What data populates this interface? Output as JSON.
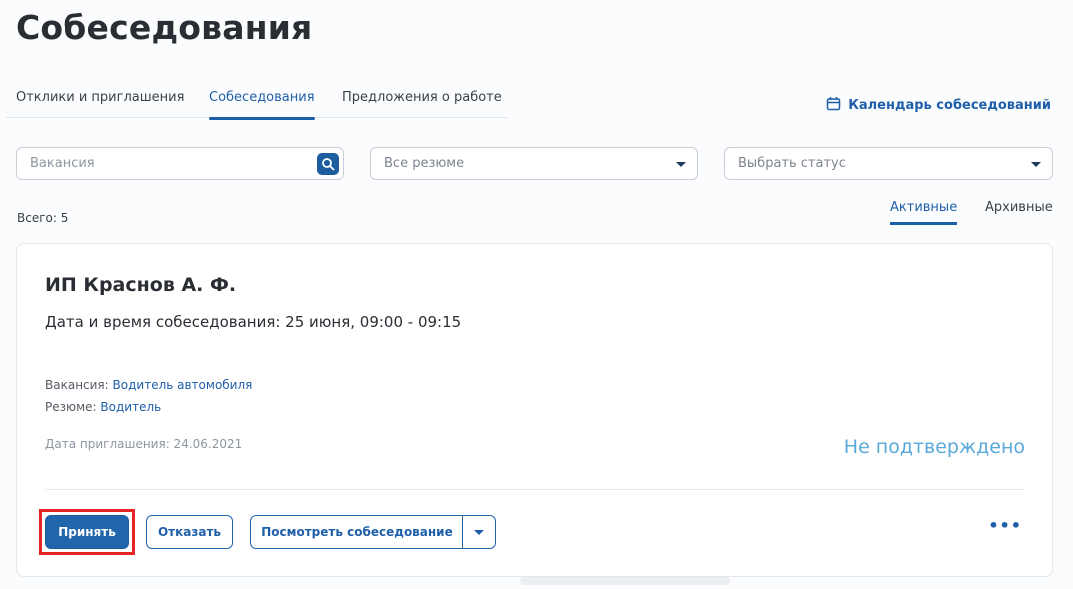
{
  "page": {
    "title": "Собеседования"
  },
  "tabs": [
    {
      "label": "Отклики и приглашения",
      "active": false
    },
    {
      "label": "Собеседования",
      "active": true
    },
    {
      "label": "Предложения о работе",
      "active": false
    }
  ],
  "calendar_link": {
    "label": "Календарь собеседований",
    "icon": "calendar-icon"
  },
  "filters": {
    "vacancy_placeholder": "Вакансия",
    "resume_select": "Все резюме",
    "status_select": "Выбрать статус"
  },
  "summary": {
    "total_label": "Всего:",
    "total_value": "5"
  },
  "subtabs": [
    {
      "label": "Активные",
      "active": true
    },
    {
      "label": "Архивные",
      "active": false
    }
  ],
  "card": {
    "company": "ИП Краснов А. Ф.",
    "datetime": "Дата и время собеседования: 25 июня, 09:00 - 09:15",
    "vacancy_label": "Вакансия:",
    "vacancy_value": "Водитель автомобиля",
    "resume_label": "Резюме:",
    "resume_value": "Водитель",
    "invite_date": "Дата приглашения: 24.06.2021",
    "status": "Не подтверждено",
    "status_color": "#5aa9db",
    "buttons": {
      "accept": "Принять",
      "decline": "Отказать",
      "view": "Посмотреть собеседование",
      "more": "•••"
    }
  },
  "colors": {
    "accent": "#2166ad",
    "highlight": "#e32525"
  }
}
